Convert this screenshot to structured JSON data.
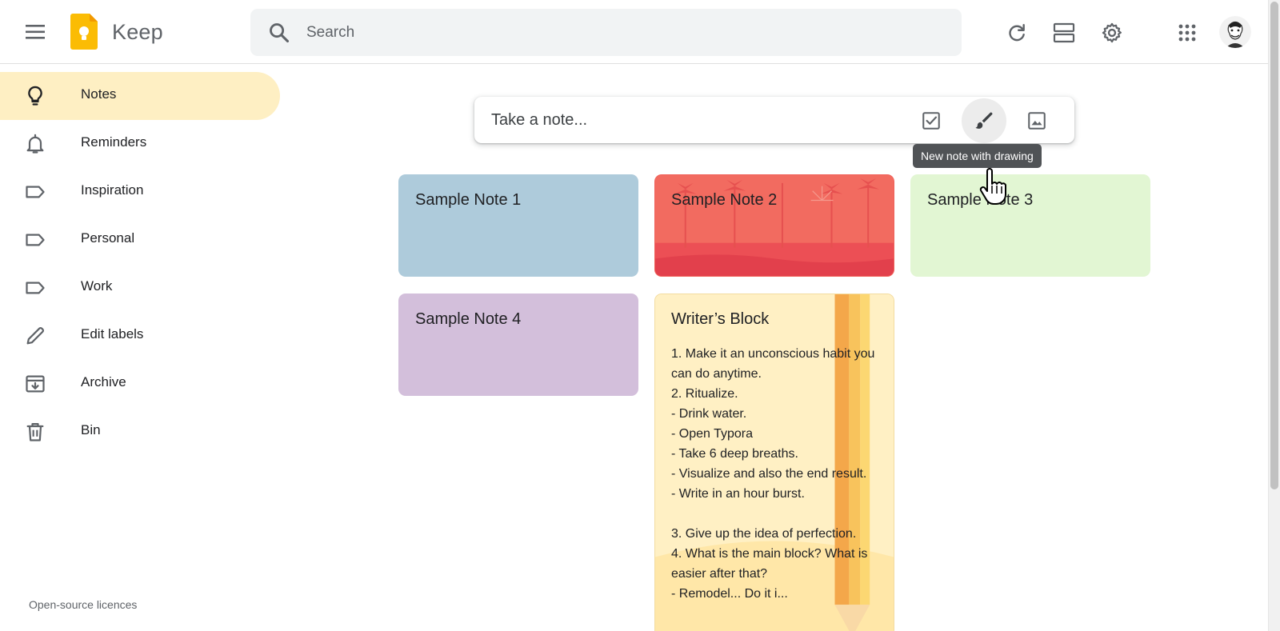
{
  "app": {
    "title": "Keep"
  },
  "search": {
    "placeholder": "Search"
  },
  "sidebar": {
    "items": [
      {
        "label": "Notes",
        "icon": "lightbulb-icon",
        "active": true
      },
      {
        "label": "Reminders",
        "icon": "bell-icon"
      },
      {
        "label": "Inspiration",
        "icon": "label-icon"
      },
      {
        "label": "Personal",
        "icon": "label-icon"
      },
      {
        "label": "Work",
        "icon": "label-icon"
      },
      {
        "label": "Edit labels",
        "icon": "pencil-icon"
      },
      {
        "label": "Archive",
        "icon": "archive-icon"
      },
      {
        "label": "Bin",
        "icon": "trash-icon"
      }
    ],
    "footer": "Open-source licences"
  },
  "take_note": {
    "placeholder": "Take a note...",
    "tooltip": "New note with drawing"
  },
  "notes": [
    {
      "title": "Sample Note 1",
      "color": "#aecbdb"
    },
    {
      "title": "Sample Note 2",
      "color": "#f0625a"
    },
    {
      "title": "Sample Note 3",
      "color": "#e2f6d3"
    },
    {
      "title": "Sample Note 4",
      "color": "#d3bfdb"
    },
    {
      "title": "Writer’s Block",
      "color": "#fff0c4",
      "body": "1. Make it an unconscious habit you can do anytime.\n2. Ritualize.\n- Drink water.\n- Open Typora\n- Take 6 deep breaths.\n- Visualize and also the end result.\n- Write in an hour burst.\n\n3. Give up the idea of perfection.\n4. What is the main block? What is easier after that?\n- Remodel... Do it i..."
    }
  ],
  "colors": {
    "accent": "#fbbc04",
    "active_nav": "#feefc3",
    "tooltip_bg": "#505356"
  }
}
